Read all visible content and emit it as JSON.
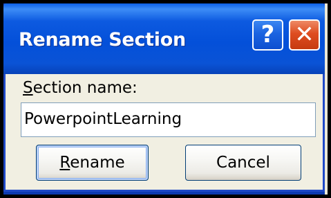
{
  "dialog": {
    "title": "Rename Section",
    "help_glyph": "?",
    "close_glyph": "✕",
    "field_label_accesskey": "S",
    "field_label_rest": "ection name:",
    "field_value": "PowerpointLearning",
    "rename_accesskey": "R",
    "rename_rest": "ename",
    "cancel_label": "Cancel"
  },
  "colors": {
    "titlebar": "#0450d9",
    "close_button": "#de4d20",
    "dialog_background": "#f1efe2",
    "frame_border": "#000000"
  },
  "icons": [
    "help-icon",
    "close-icon"
  ]
}
